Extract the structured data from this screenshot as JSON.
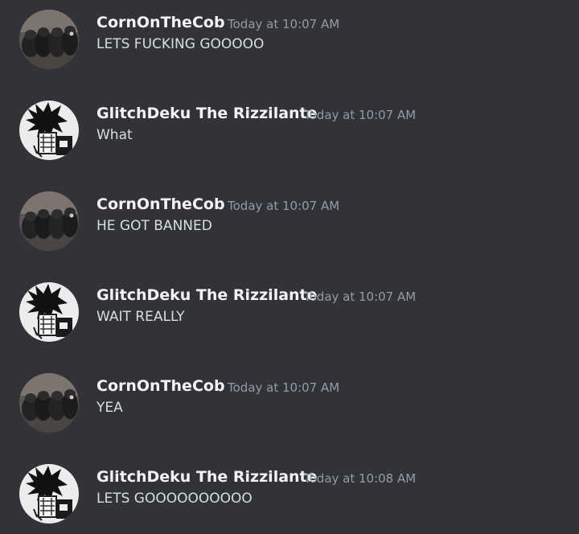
{
  "messages": [
    {
      "author": "CornOnTheCob",
      "avatar_icon": "puppies-avatar-icon",
      "timestamp": "Today at 10:07 AM",
      "text": "LETS FUCKING GOOOOO"
    },
    {
      "author": "GlitchDeku The Rizzilante",
      "avatar_icon": "anime-character-avatar-icon",
      "timestamp": "Today at 10:07 AM",
      "text": "What"
    },
    {
      "author": "CornOnTheCob",
      "avatar_icon": "puppies-avatar-icon",
      "timestamp": "Today at 10:07 AM",
      "text": "HE GOT BANNED"
    },
    {
      "author": "GlitchDeku The Rizzilante",
      "avatar_icon": "anime-character-avatar-icon",
      "timestamp": "Today at 10:07 AM",
      "text": "WAIT REALLY"
    },
    {
      "author": "CornOnTheCob",
      "avatar_icon": "puppies-avatar-icon",
      "timestamp": "Today at 10:07 AM",
      "text": "YEA"
    },
    {
      "author": "GlitchDeku The Rizzilante",
      "avatar_icon": "anime-character-avatar-icon",
      "timestamp": "Today at 10:08 AM",
      "text": "LETS GOOOOOOOOOO"
    }
  ],
  "colors": {
    "background": "#313338",
    "username": "#f2f3f5",
    "timestamp": "#949ba4",
    "message_text": "#dbdee1"
  }
}
